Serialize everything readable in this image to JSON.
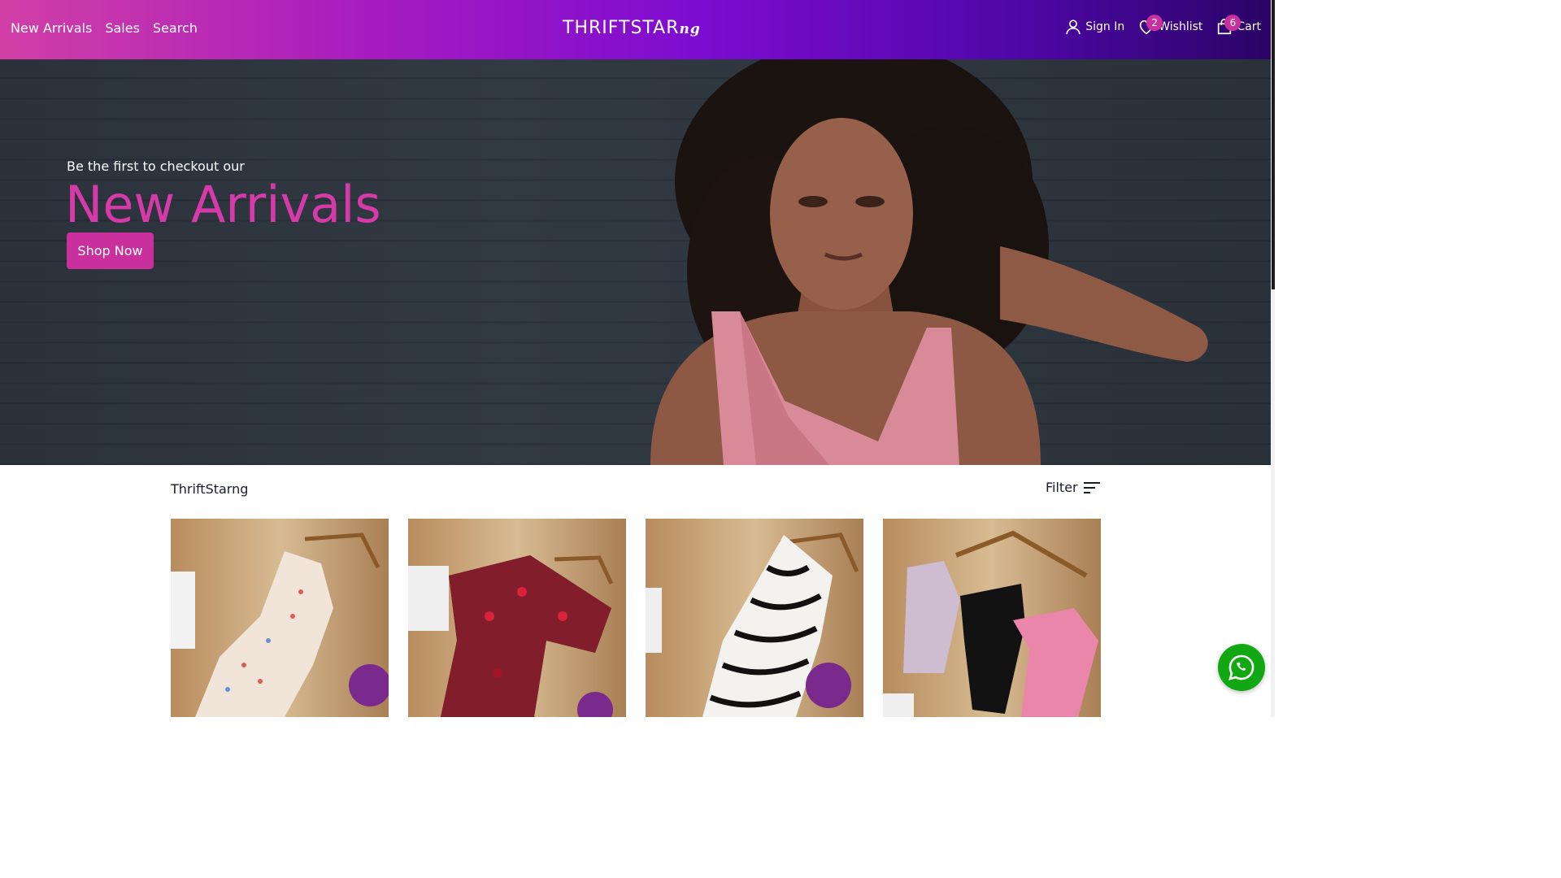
{
  "header": {
    "nav_left": [
      "New Arrivals",
      "Sales",
      "Search"
    ],
    "logo_main": "THRIFTSTAR",
    "logo_suffix": "ng",
    "sign_in": "Sign In",
    "wishlist": "Wishlist",
    "wishlist_count": "2",
    "cart": "Cart",
    "cart_count": "6"
  },
  "hero": {
    "subtitle": "Be the first to checkout our",
    "title": "New Arrivals",
    "button": "Shop Now"
  },
  "catalog": {
    "store_name": "ThriftStarng",
    "filter_label": "Filter",
    "products": [
      {
        "name": "floral-slip-dress",
        "colors": [
          "#f1e4d8",
          "#e05a5a",
          "#6b8fd6"
        ]
      },
      {
        "name": "red-print-dress",
        "colors": [
          "#1a1a1a",
          "#d8233a",
          "#a01424"
        ]
      },
      {
        "name": "zebra-print-dress",
        "colors": [
          "#f4f2ee",
          "#111111",
          "#555555"
        ]
      },
      {
        "name": "biker-shorts-set",
        "colors": [
          "#e9b2c8",
          "#121212",
          "#eb86ab"
        ]
      }
    ]
  },
  "colors": {
    "accent": "#c9309e",
    "header_gradient_start": "#d13fa6",
    "header_gradient_end": "#2a0466",
    "whatsapp": "#11a814"
  }
}
